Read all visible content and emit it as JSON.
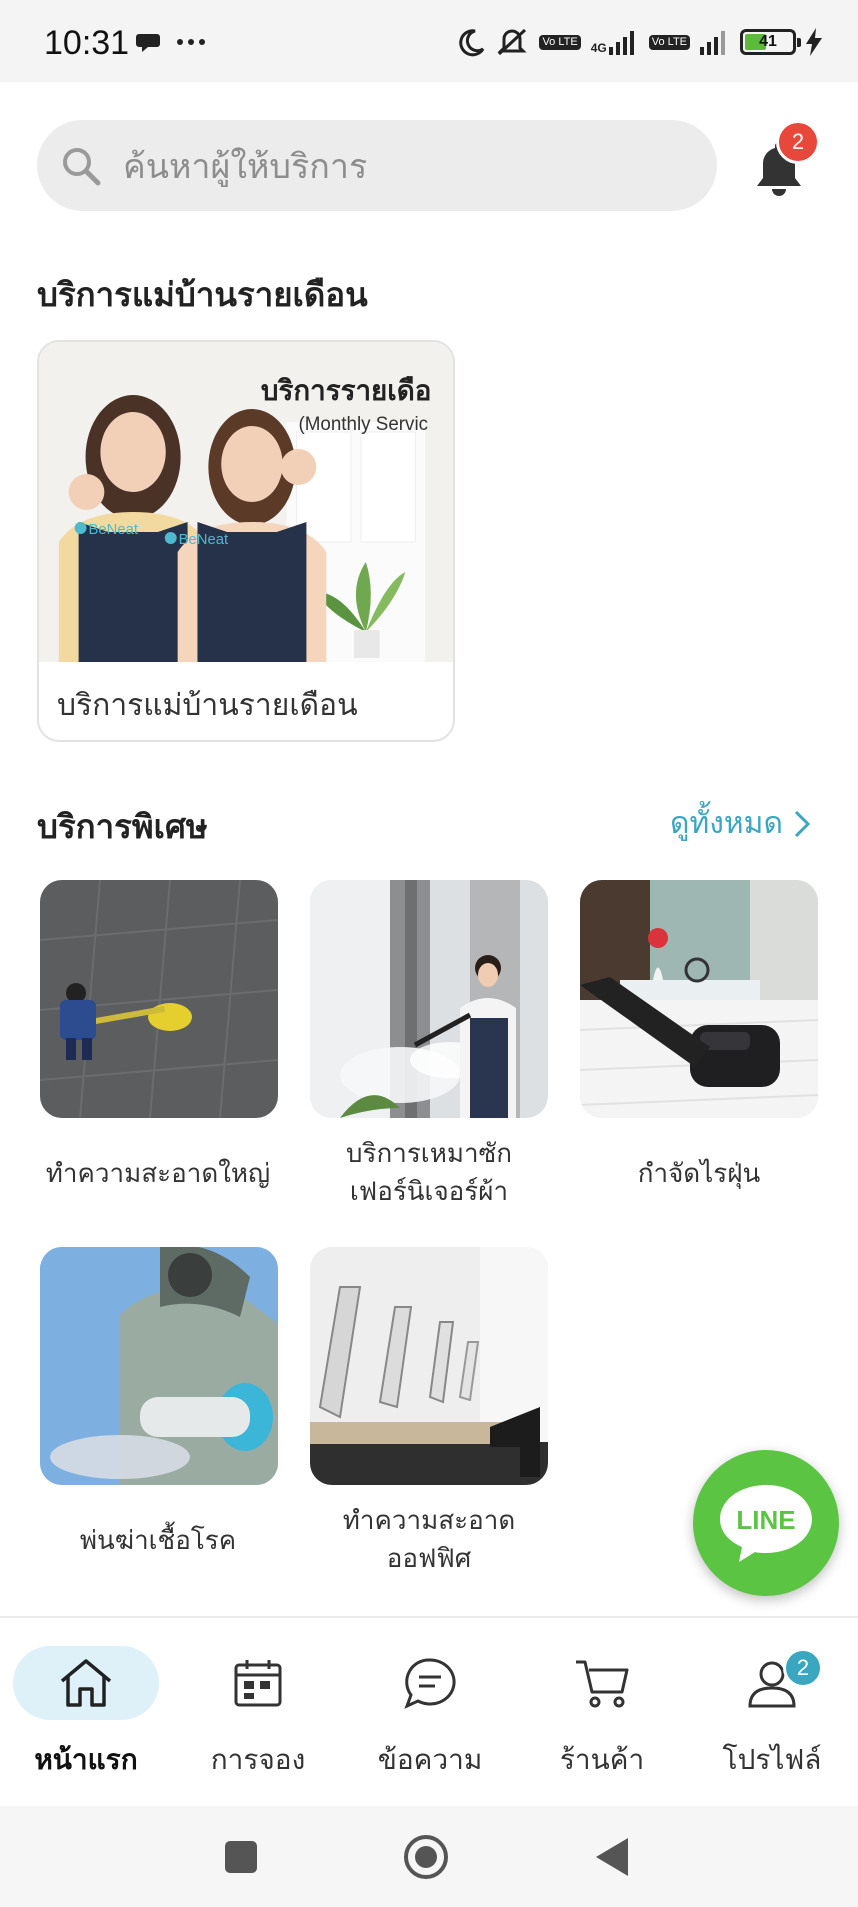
{
  "status_bar": {
    "time": "10:31",
    "battery": "41",
    "network": "4G",
    "volte": "Vo LTE"
  },
  "search": {
    "placeholder": "ค้นหาผู้ให้บริการ"
  },
  "notifications": {
    "count": "2"
  },
  "monthly_section": {
    "title": "บริการแม่บ้านรายเดือน",
    "card": {
      "label": "บริการแม่บ้านรายเดือน",
      "banner_title": "บริการรายเดือ",
      "banner_subtitle": "(Monthly Servic",
      "logo_text": "BeNeat"
    }
  },
  "special_section": {
    "title": "บริการพิเศษ",
    "see_all": "ดูทั้งหมด",
    "items": [
      {
        "line1": "ทำความสะอาดใหญ่",
        "line2": ""
      },
      {
        "line1": "บริการเหมาซัก",
        "line2": "เฟอร์นิเจอร์ผ้า"
      },
      {
        "line1": "กำจัดไรฝุ่น",
        "line2": ""
      },
      {
        "line1": "พ่นฆ่าเชื้อโรค",
        "line2": ""
      },
      {
        "line1": "ทำความสะอาด",
        "line2": "ออฟฟิศ"
      }
    ]
  },
  "line_button": {
    "label": "LINE"
  },
  "bottom_nav": {
    "items": [
      {
        "label": "หน้าแรก",
        "icon": "home-icon"
      },
      {
        "label": "การจอง",
        "icon": "calendar-icon"
      },
      {
        "label": "ข้อความ",
        "icon": "chat-icon"
      },
      {
        "label": "ร้านค้า",
        "icon": "cart-icon"
      },
      {
        "label": "โปรไฟล์",
        "icon": "profile-icon"
      }
    ],
    "profile_badge": "2"
  },
  "colors": {
    "accent": "#3aa6bf",
    "badge_red": "#e8473c",
    "line_green": "#5cc443",
    "nav_active_bg": "#dff1f8"
  }
}
